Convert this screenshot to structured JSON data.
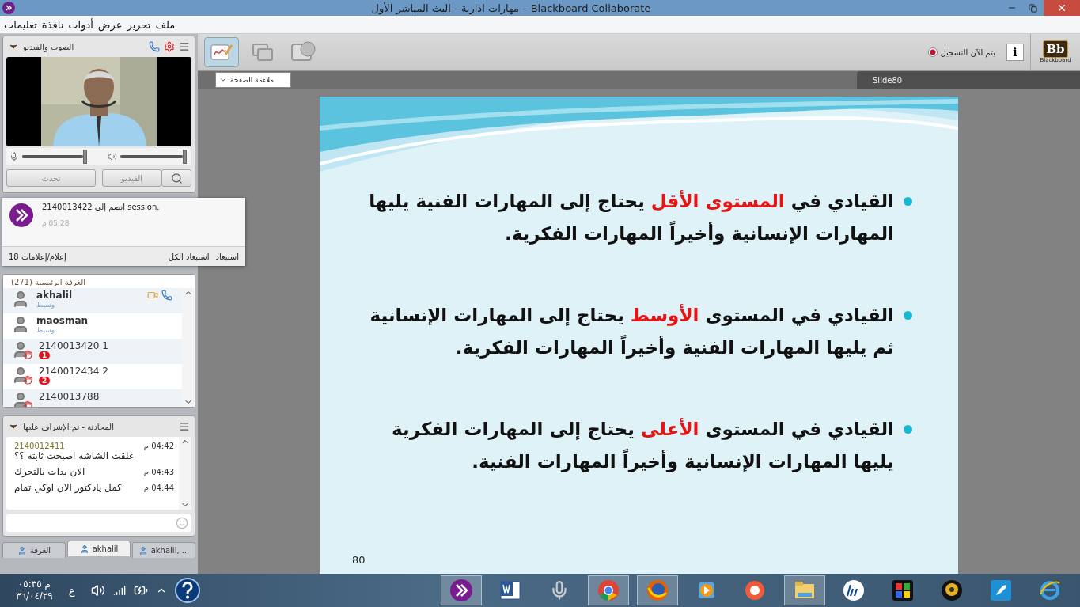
{
  "window": {
    "title": "مهارات ادارية - البث المباشر الأول – Blackboard Collaborate"
  },
  "menu": [
    "ملف",
    "تحرير",
    "عرض",
    "أدوات",
    "نافذة",
    "تعليمات"
  ],
  "audio_video": {
    "title": "الصوت والفيديو",
    "mic": {
      "level": 0.95
    },
    "speaker": {
      "level": 0.98
    },
    "talk_button": "تحدث",
    "video_button": "الفيديو"
  },
  "notification": {
    "message": "2140013422 انضم إلى session.",
    "time": "05:28 م",
    "count": "18 إعلام/إعلامات",
    "dismiss": "استبعاد",
    "dismiss_all": "استبعاد الكل"
  },
  "participants": {
    "title": "(271) الغرفة الرئيسية",
    "items": [
      {
        "kind": "moderator",
        "name": "akhalil",
        "role": "وسيط",
        "media": true
      },
      {
        "kind": "moderator",
        "name": "maosman",
        "role": "وسيط",
        "media": false
      },
      {
        "kind": "hand",
        "name": "2140013420 1",
        "badge": "1"
      },
      {
        "kind": "hand",
        "name": "2140012434 2",
        "badge": "2"
      },
      {
        "kind": "hand",
        "name": "2140013788"
      }
    ]
  },
  "chat": {
    "title": "المحادثة - تم الإشراف عليها",
    "messages": [
      {
        "sender": "2140012411",
        "time": "04:42 م",
        "text": "علقت الشاشه اصبحت ثابته ؟؟"
      },
      {
        "time": "04:43 م",
        "text": "الان بدات بالتحرك"
      },
      {
        "time": "04:44 م",
        "text": "كمل يادكتور الان اوكي تمام"
      }
    ]
  },
  "room_tabs": [
    {
      "label": "akhalil, ...",
      "selected": false
    },
    {
      "label": "akhalil",
      "selected": true
    },
    {
      "label": "الغرفة",
      "selected": false
    }
  ],
  "toolbar": {
    "tools": [
      {
        "kind": "whiteboard",
        "selected": true
      },
      {
        "kind": "app_share",
        "selected": false
      },
      {
        "kind": "web_tour",
        "selected": false
      }
    ],
    "recording": {
      "label": "يتم الآن التسجيل",
      "on": true
    },
    "info_button": "i",
    "logo": {
      "mark": "Bb",
      "name": "Blackboard"
    }
  },
  "view": {
    "zoom": "ملاءمة الصفحة",
    "slide_tab": "Slide80"
  },
  "slide": {
    "bullets": [
      {
        "parts": [
          {
            "text": "القيادي في ",
            "highlight": false
          },
          {
            "text": "المستوى الأقل",
            "highlight": true
          },
          {
            "text": " يحتاج إلى المهارات الفنية يليها المهارات الإنسانية وأخيراً المهارات الفكرية.",
            "highlight": false
          }
        ]
      },
      {
        "parts": [
          {
            "text": "القيادي في المستوى ",
            "highlight": false
          },
          {
            "text": "الأوسط",
            "highlight": true
          },
          {
            "text": " يحتاج إلى المهارات الإنسانية ثم يليها المهارات الفنية وأخيراً المهارات الفكرية.",
            "highlight": false
          }
        ]
      },
      {
        "parts": [
          {
            "text": "القيادي في المستوى ",
            "highlight": false
          },
          {
            "text": "الأعلى",
            "highlight": true
          },
          {
            "text": " يحتاج إلى المهارات الفكرية يليها المهارات الإنسانية وأخيراً المهارات الفنية.",
            "highlight": false
          }
        ]
      }
    ],
    "page_number": "80"
  },
  "taskbar": {
    "clock": {
      "time": "م ٠٥:٣٥",
      "date": "٣٦/٠٤/٢٩"
    },
    "language": "ع",
    "apps": [
      {
        "kind": "collaborate",
        "open": true
      },
      {
        "kind": "word",
        "open": false
      },
      {
        "kind": "microphone",
        "open": false
      },
      {
        "kind": "chrome",
        "open": true
      },
      {
        "kind": "firefox",
        "open": true
      },
      {
        "kind": "player",
        "open": false
      },
      {
        "kind": "recorder",
        "open": false
      },
      {
        "kind": "explorer",
        "open": true
      },
      {
        "kind": "hp",
        "open": false
      },
      {
        "kind": "puzzle",
        "open": false
      },
      {
        "kind": "webcam",
        "open": false
      },
      {
        "kind": "rocket",
        "open": false
      },
      {
        "kind": "browser",
        "open": false
      }
    ]
  }
}
